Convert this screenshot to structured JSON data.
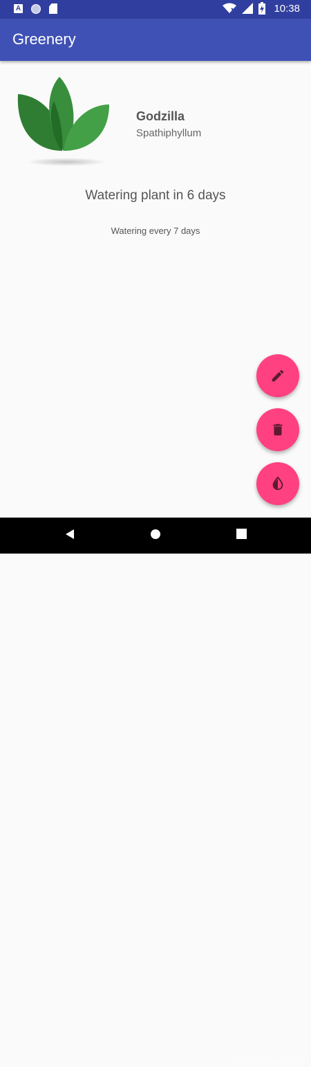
{
  "status_bar": {
    "time": "10:38",
    "notification_icons": [
      "a-icon",
      "circle-icon",
      "sd-card-icon"
    ],
    "system_icons": [
      "wifi-icon",
      "signal-icon",
      "battery-icon"
    ]
  },
  "app_bar": {
    "title": "Greenery"
  },
  "plant": {
    "name": "Godzilla",
    "species": "Spathiphyllum",
    "watering_status": "Watering plant in 6 days",
    "watering_interval": "Watering every 7 days"
  },
  "fabs": [
    {
      "name": "edit-fab",
      "icon": "pencil-icon"
    },
    {
      "name": "delete-fab",
      "icon": "trash-icon"
    },
    {
      "name": "water-fab",
      "icon": "water-drop-icon"
    }
  ],
  "nav_bar": {
    "buttons": [
      "back-icon",
      "home-icon",
      "recents-icon"
    ]
  },
  "watermark": "softlookup.com",
  "colors": {
    "status_bar": "#303f9f",
    "app_bar": "#3f51b5",
    "accent": "#ff4081",
    "background": "#fafafa"
  }
}
